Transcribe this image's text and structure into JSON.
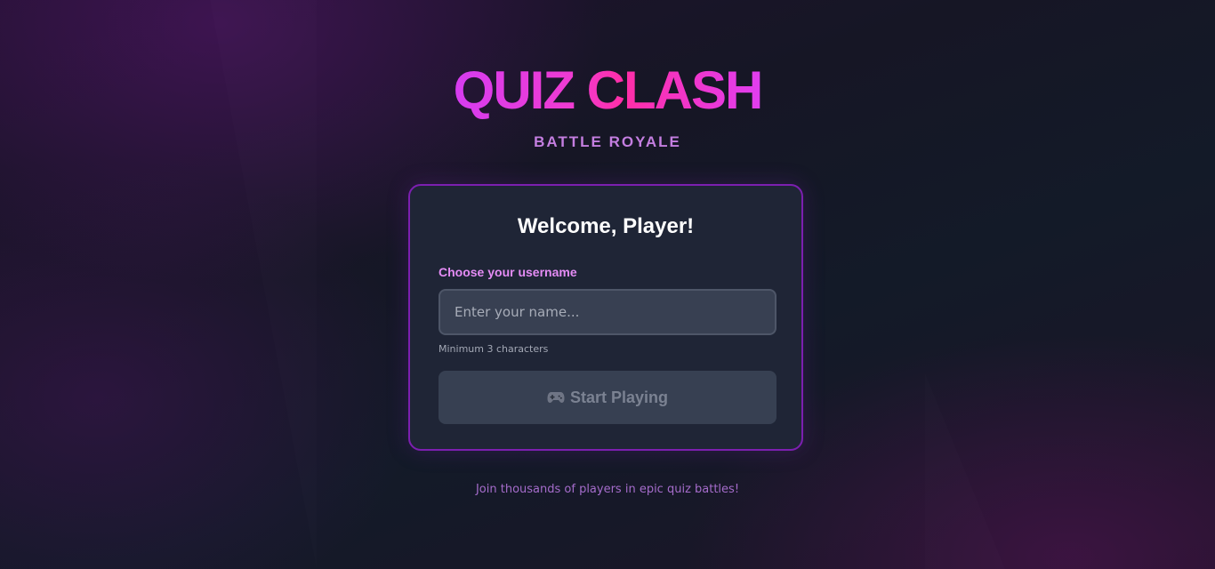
{
  "header": {
    "title": "QUIZ CLASH",
    "subtitle": "BATTLE ROYALE"
  },
  "login_card": {
    "heading": "Welcome, Player!",
    "username_label": "Choose your username",
    "username_placeholder": "Enter your name...",
    "username_value": "",
    "hint": "Minimum 3 characters",
    "start_button": {
      "icon": "gamepad-icon",
      "label": "Start Playing",
      "enabled": false
    }
  },
  "footer": {
    "tagline": "Join thousands of players in epic quiz battles!"
  },
  "colors": {
    "accent_purple": "#7c1fb0",
    "title_gradient_start": "#d63cf0",
    "title_gradient_mid": "#ff2ea7",
    "label_pink": "#e58cf5",
    "subtitle": "#c47ee0",
    "card_background": "#1f2536",
    "button_disabled_bg": "#374052",
    "button_disabled_text": "#7b8292"
  }
}
